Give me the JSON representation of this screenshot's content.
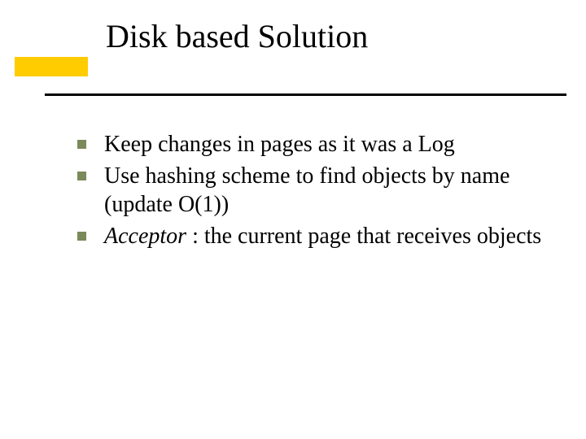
{
  "title": "Disk based Solution",
  "bullets": {
    "b0": "Keep changes in pages as it was a Log",
    "b1": "Use hashing scheme to find objects by name (update O(1))",
    "b2_emph": "Acceptor",
    "b2_rest": " : the current page that receives objects"
  }
}
